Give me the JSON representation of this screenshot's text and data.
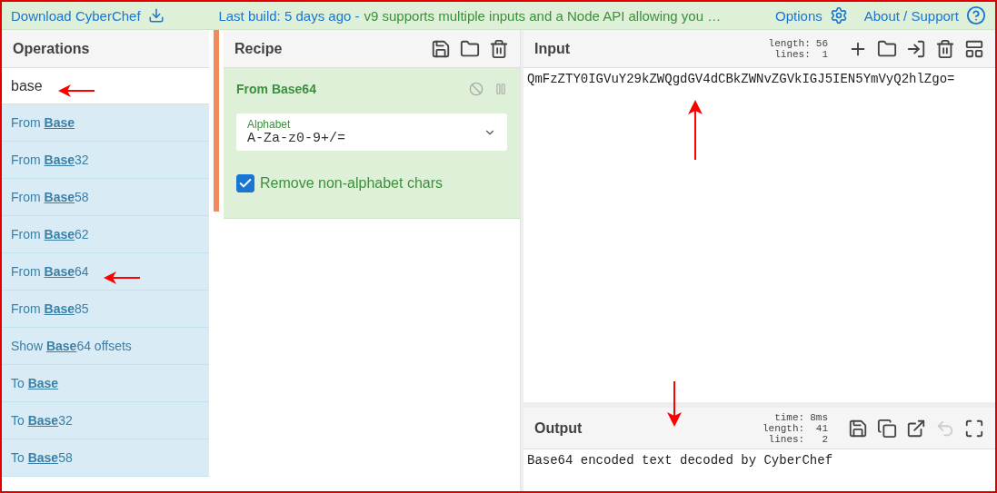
{
  "banner": {
    "download": "Download CyberChef",
    "build": "Last build: 5 days ago -",
    "notice": "v9 supports multiple inputs and a Node API allowing you …",
    "options": "Options",
    "about": "About / Support"
  },
  "operations": {
    "title": "Operations",
    "search": "base",
    "items": [
      {
        "label": "From **Base**"
      },
      {
        "label": "From **Base**32"
      },
      {
        "label": "From **Base**58"
      },
      {
        "label": "From **Base**62"
      },
      {
        "label": "From **Base**64"
      },
      {
        "label": "From **Base**85"
      },
      {
        "label": "Show **Base**64 offsets"
      },
      {
        "label": "To **Base**"
      },
      {
        "label": "To **Base**32"
      },
      {
        "label": "To **Base**58"
      }
    ]
  },
  "recipe": {
    "title": "Recipe",
    "operation": {
      "name": "From Base64",
      "disabled": false,
      "paused": false,
      "alphabet_label": "Alphabet",
      "alphabet": "A-Za-z0-9+/=",
      "remove_label": "Remove non-alphabet chars",
      "remove_checked": true
    }
  },
  "input": {
    "title": "Input",
    "stats": [
      {
        "key": "length:",
        "value": "56"
      },
      {
        "key": "lines:",
        "value": "1"
      }
    ],
    "text": "QmFzZTY0IGVuY29kZWQgdGV4dCBkZWNvZGVkIGJ5IEN5YmVyQ2hlZgo="
  },
  "output": {
    "title": "Output",
    "stats": [
      {
        "key": "time:",
        "value": "8ms"
      },
      {
        "key": "length:",
        "value": "41"
      },
      {
        "key": "lines:",
        "value": "2"
      }
    ],
    "undo_disabled": true,
    "text": "Base64 encoded text decoded by CyberChef"
  },
  "annotations": [
    {
      "kind": "left"
    },
    {
      "kind": "left"
    },
    {
      "kind": "up"
    },
    {
      "kind": "down"
    }
  ]
}
